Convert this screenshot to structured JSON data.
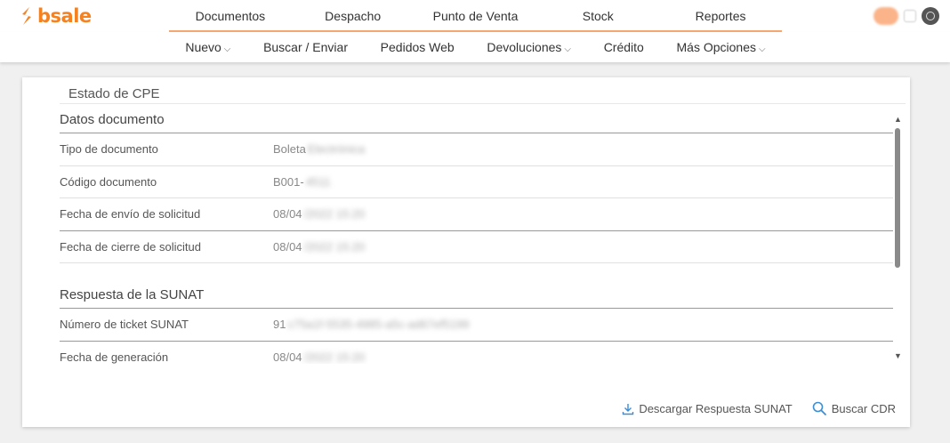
{
  "brand": {
    "name": "bsale",
    "color": "#f58220"
  },
  "primary_nav": [
    "Documentos",
    "Despacho",
    "Punto de Venta",
    "Stock",
    "Reportes"
  ],
  "sub_nav": [
    {
      "label": "Nuevo",
      "dropdown": true
    },
    {
      "label": "Buscar / Enviar",
      "dropdown": false
    },
    {
      "label": "Pedidos Web",
      "dropdown": false
    },
    {
      "label": "Devoluciones",
      "dropdown": true
    },
    {
      "label": "Crédito",
      "dropdown": false
    },
    {
      "label": "Más Opciones",
      "dropdown": true
    }
  ],
  "panel": {
    "title": "Estado de CPE",
    "sections": [
      {
        "title": "Datos documento",
        "rows": [
          {
            "label": "Tipo de documento",
            "value": "Boleta",
            "redacted": "Electrónica"
          },
          {
            "label": "Código documento",
            "value": "B001-",
            "redacted": "4511"
          },
          {
            "label": "Fecha de envío de solicitud",
            "value": "08/04",
            "redacted": "/2022 15:20"
          },
          {
            "label": "Fecha de cierre de solicitud",
            "value": "08/04",
            "redacted": "/2022 15:20"
          }
        ]
      },
      {
        "title": "Respuesta de la SUNAT",
        "rows": [
          {
            "label": "Número de ticket SUNAT",
            "value": "91",
            "redacted": "c75a1f-5535-4985-a5c-ad67ef5199"
          },
          {
            "label": "Fecha de generación",
            "value": "08/04",
            "redacted": "/2022 15:20"
          }
        ]
      }
    ],
    "actions": {
      "download": "Descargar Respuesta SUNAT",
      "search_cdr": "Buscar CDR"
    }
  },
  "icons": [
    "logo-icon",
    "chevron-down-icon",
    "scroll-up-icon",
    "scroll-down-icon",
    "download-icon",
    "search-icon",
    "user-avatar-icon"
  ]
}
